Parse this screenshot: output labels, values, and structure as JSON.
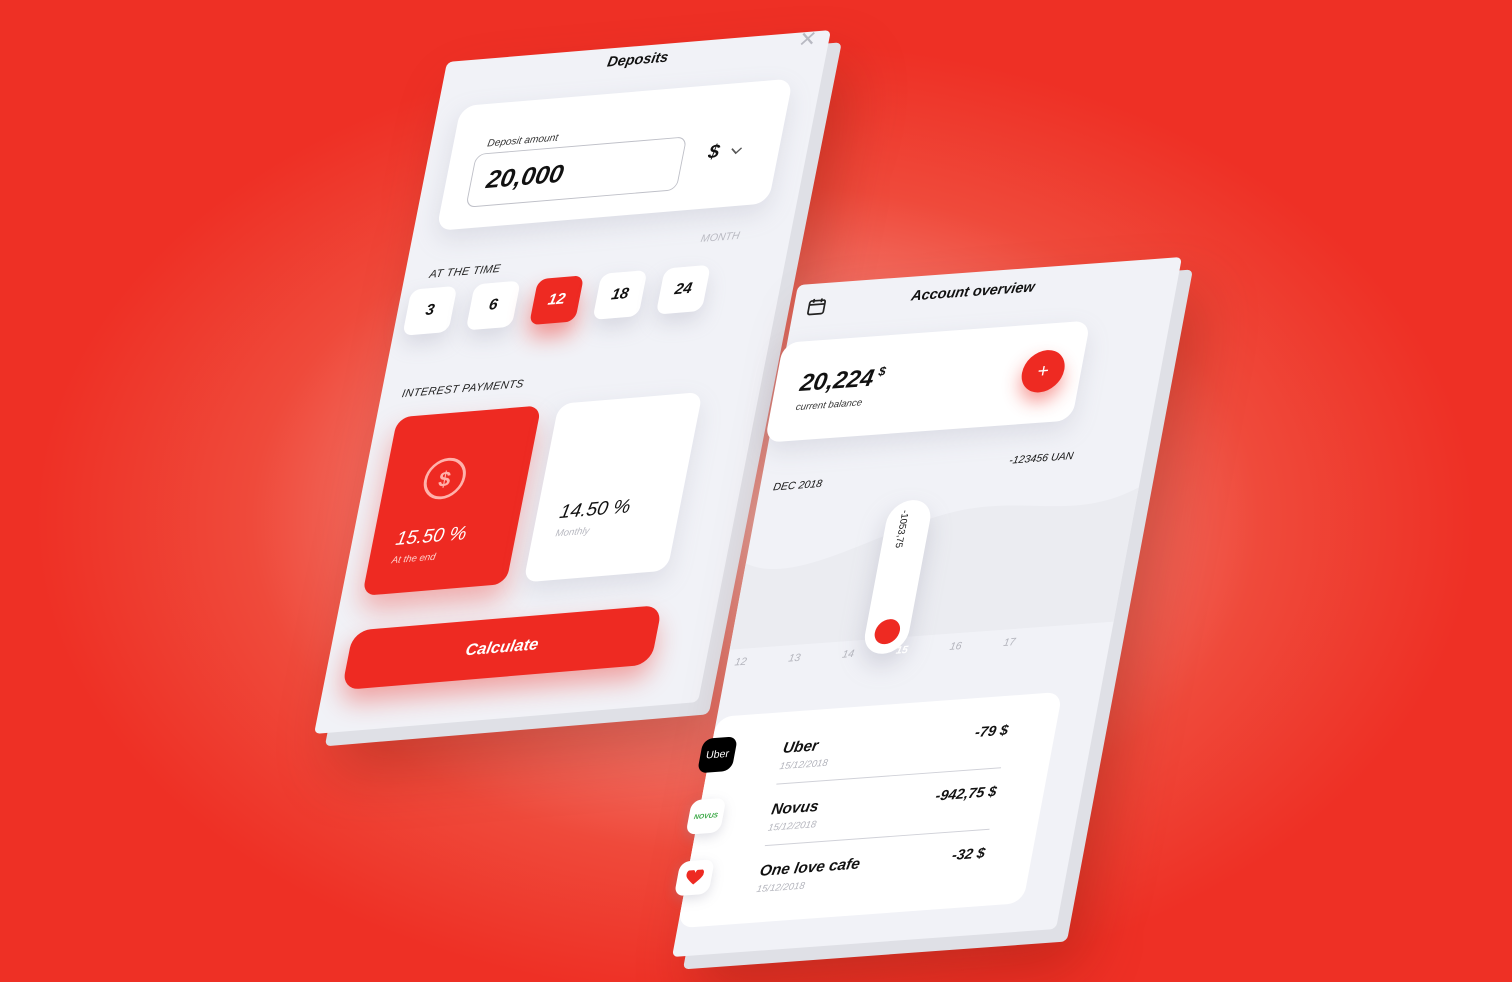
{
  "deposits": {
    "title": "Deposits",
    "close_icon": "close-icon",
    "deposit_amount_label": "Deposit amount",
    "deposit_amount_value": "20,000",
    "currency": "$",
    "term_label": "AT THE TIME",
    "term_unit": "MONTH",
    "terms": [
      "3",
      "6",
      "12",
      "18",
      "24"
    ],
    "selected_term": "12",
    "interest_label": "INTEREST PAYMENTS",
    "options": [
      {
        "rate": "15.50 %",
        "caption": "At the end",
        "icon": "dollar-coin-icon",
        "selected": true
      },
      {
        "rate": "14.50 %",
        "caption": "Monthly",
        "selected": false
      }
    ],
    "calculate_label": "Calculate"
  },
  "overview": {
    "title": "Account overview",
    "calendar_icon": "calendar-icon",
    "balance_value": "20,224",
    "balance_currency": "$",
    "balance_label": "current balance",
    "add_label": "+",
    "period": "DEC 2018",
    "period_total": "-123456 UAN",
    "day_value": "-1053,75",
    "days": [
      "12",
      "13",
      "14",
      "15",
      "16",
      "17"
    ],
    "selected_day": "15",
    "transactions": [
      {
        "name": "Uber",
        "date": "15/12/2018",
        "amount": "-79 $",
        "logo_text": "Uber"
      },
      {
        "name": "Novus",
        "date": "15/12/2018",
        "amount": "-942,75 $",
        "logo_text": "NOVUS"
      },
      {
        "name": "One love cafe",
        "date": "15/12/2018",
        "amount": "-32 $",
        "logo_icon": "heart-icon"
      }
    ]
  },
  "colors": {
    "accent": "#ee2a22",
    "surface": "#f1f2f7"
  }
}
